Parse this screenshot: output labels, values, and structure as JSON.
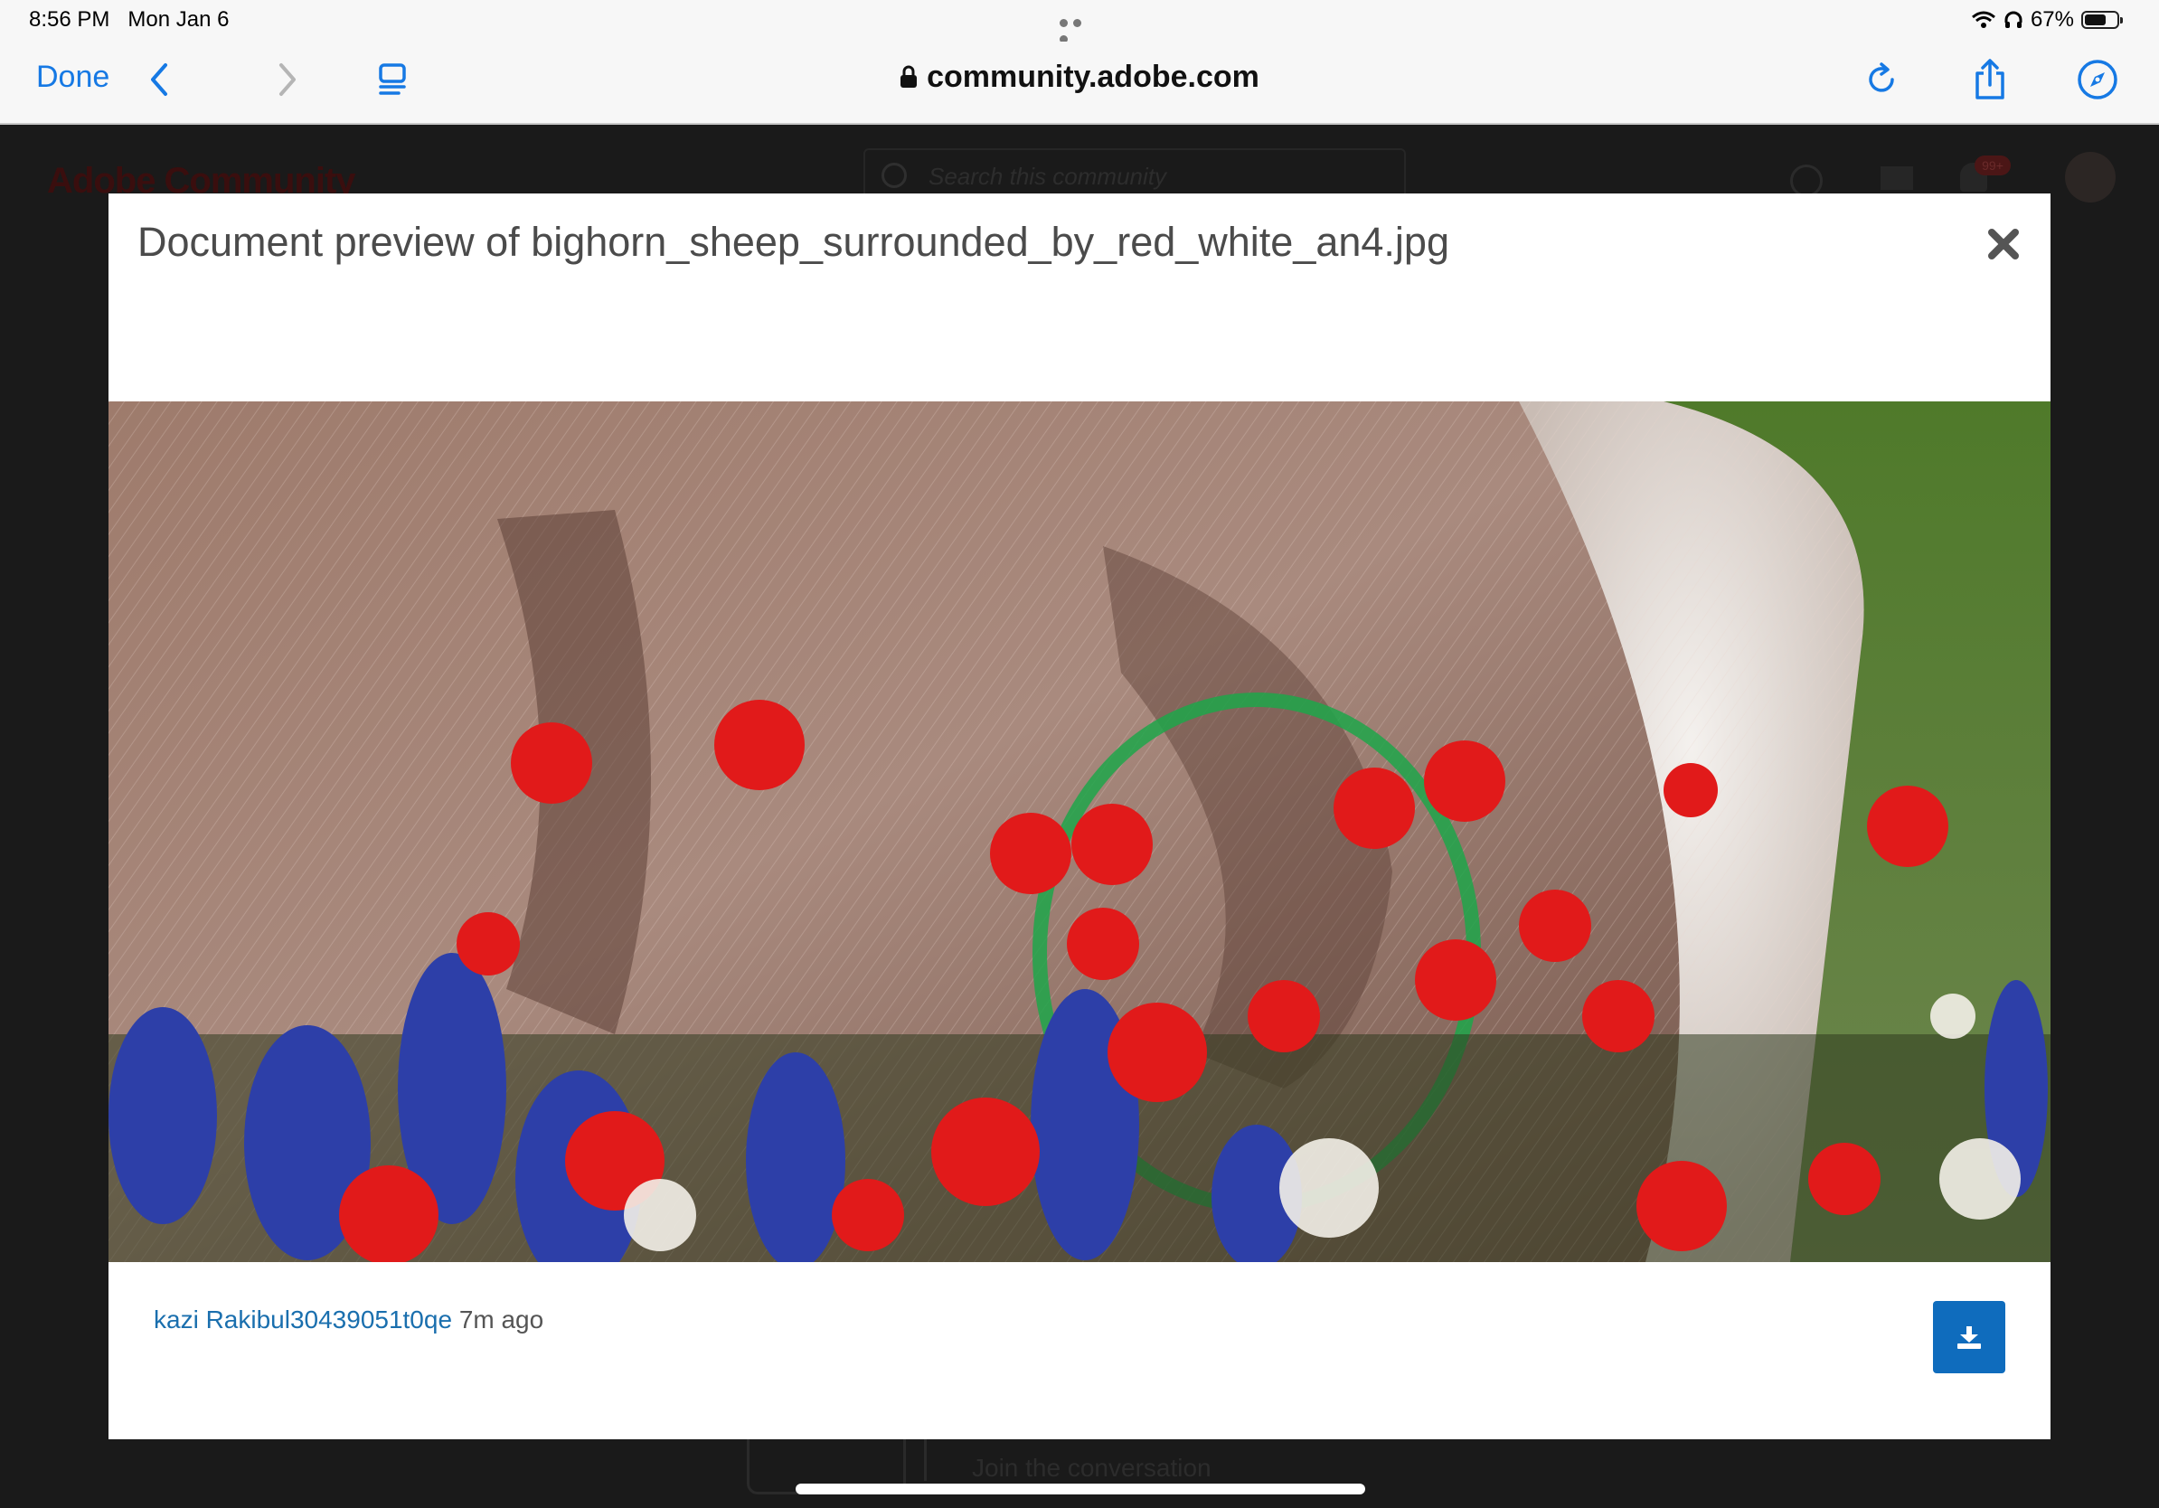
{
  "status_bar": {
    "time": "8:56 PM",
    "date": "Mon Jan 6",
    "battery": "67%",
    "battery_level": 0.67
  },
  "browser": {
    "done_label": "Done",
    "url": "community.adobe.com",
    "icons": [
      "chevron-left-icon",
      "chevron-right-icon",
      "reader-icon",
      "lock-icon",
      "reload-icon",
      "share-icon",
      "compass-icon"
    ]
  },
  "background_page": {
    "logo": "Adobe Community",
    "search_placeholder": "Search this community",
    "notifications_badge": "99+",
    "join_text": "Join the conversation"
  },
  "modal": {
    "title": "Document preview of bighorn_sheep_surrounded_by_red_white_an4.jpg",
    "author": "kazi Rakibul30439051t0qe",
    "time_ago": "7m ago"
  },
  "colors": {
    "accent": "#1679e4",
    "link": "#1a6fae",
    "download_button": "#0f6cbd",
    "annotation_circle": "#1fa64a"
  }
}
